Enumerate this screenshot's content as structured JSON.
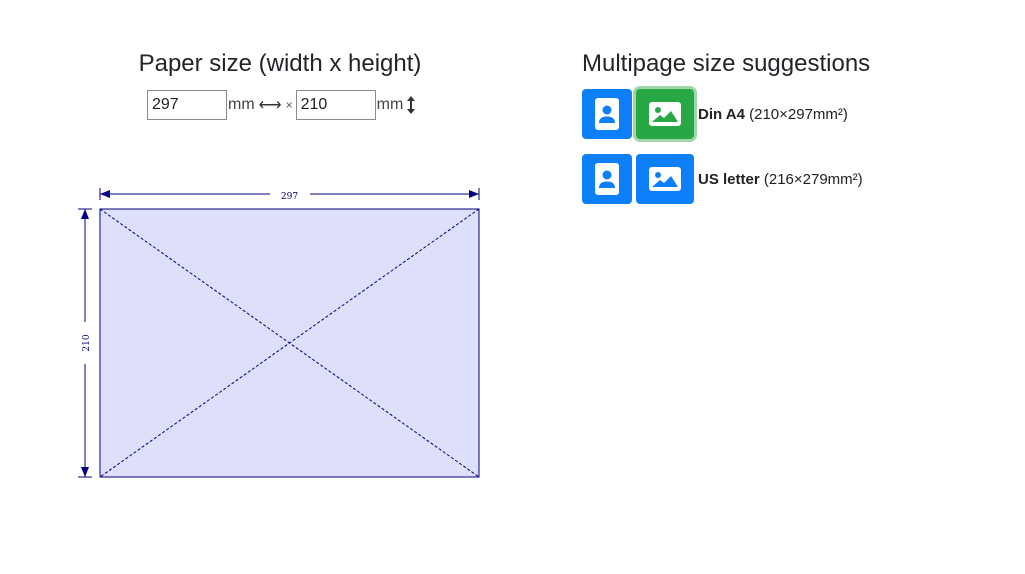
{
  "paper": {
    "title": "Paper size (width x height)",
    "width_value": "297",
    "height_value": "210",
    "unit": "mm",
    "times": "×",
    "preview": {
      "width_label": "297",
      "height_label": "210",
      "fill_color": "#dedffb",
      "line_color": "#000080"
    }
  },
  "suggestions": {
    "title": "Multipage size suggestions",
    "items": [
      {
        "name": "Din A4",
        "dims": "(210×297mm²)",
        "active": "landscape"
      },
      {
        "name": "US letter",
        "dims": "(216×279mm²)",
        "active": "none"
      }
    ]
  },
  "icons": {
    "portrait": "portrait-person-icon",
    "landscape": "landscape-image-icon",
    "width": "horizontal-double-arrow-icon",
    "height": "vertical-double-arrow-icon"
  },
  "colors": {
    "primary": "#0d7ff9",
    "active": "#28a745",
    "active_ring": "#9fd7ab"
  }
}
